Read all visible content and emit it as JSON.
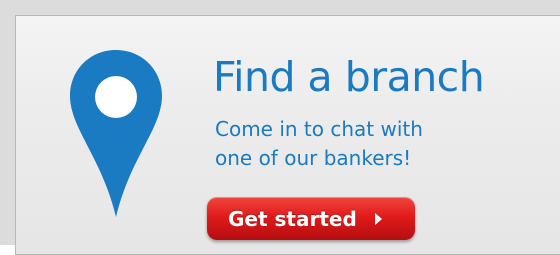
{
  "banner": {
    "title": "Find a branch",
    "subtitle_line1": "Come in to chat with",
    "subtitle_line2": "one of our bankers!",
    "cta_label": "Get started"
  },
  "icons": {
    "pin": "map-pin-icon",
    "cta_arrow": "chevron-right-icon"
  },
  "colors": {
    "brand_blue": "#1a7ac2",
    "cta_red": "#e11b1b",
    "card_bg": "#ececec"
  }
}
